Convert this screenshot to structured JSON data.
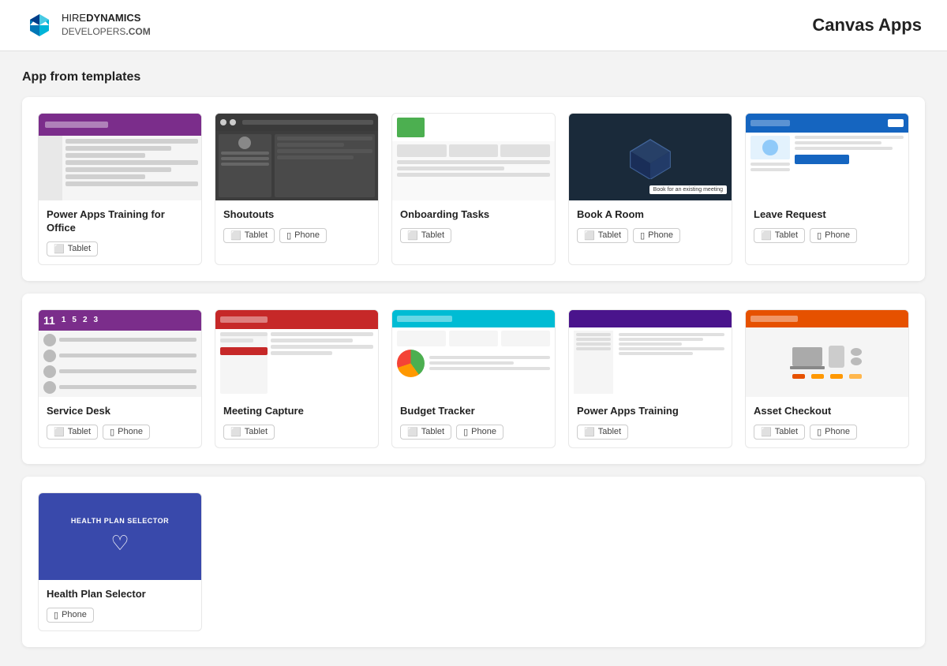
{
  "header": {
    "logo_line1_hire": "HIRE",
    "logo_line1_dynamics": "DYNAMICS",
    "logo_line2_developers": "DEVELOPERS",
    "logo_line2_com": ".COM",
    "page_title": "Canvas Apps"
  },
  "section": {
    "title": "App from templates"
  },
  "apps_row1": [
    {
      "id": "power-apps-office",
      "name": "Power Apps Training for Office",
      "badges": [
        "Tablet"
      ]
    },
    {
      "id": "shoutouts",
      "name": "Shoutouts",
      "badges": [
        "Tablet",
        "Phone"
      ]
    },
    {
      "id": "onboarding-tasks",
      "name": "Onboarding Tasks",
      "badges": [
        "Tablet"
      ]
    },
    {
      "id": "book-a-room",
      "name": "Book A Room",
      "badges": [
        "Tablet",
        "Phone"
      ]
    },
    {
      "id": "leave-request",
      "name": "Leave Request",
      "badges": [
        "Tablet",
        "Phone"
      ]
    }
  ],
  "apps_row2": [
    {
      "id": "service-desk",
      "name": "Service Desk",
      "badges": [
        "Tablet",
        "Phone"
      ]
    },
    {
      "id": "meeting-capture",
      "name": "Meeting Capture",
      "badges": [
        "Tablet"
      ]
    },
    {
      "id": "budget-tracker",
      "name": "Budget Tracker",
      "badges": [
        "Tablet",
        "Phone"
      ]
    },
    {
      "id": "power-apps-training",
      "name": "Power Apps Training",
      "badges": [
        "Tablet"
      ]
    },
    {
      "id": "asset-checkout",
      "name": "Asset Checkout",
      "badges": [
        "Tablet",
        "Phone"
      ]
    }
  ],
  "apps_row3": [
    {
      "id": "health-plan-selector",
      "name": "Health Plan Selector",
      "badges": [
        "Phone"
      ]
    }
  ],
  "badge_icons": {
    "Tablet": "▬",
    "Phone": "📱"
  }
}
